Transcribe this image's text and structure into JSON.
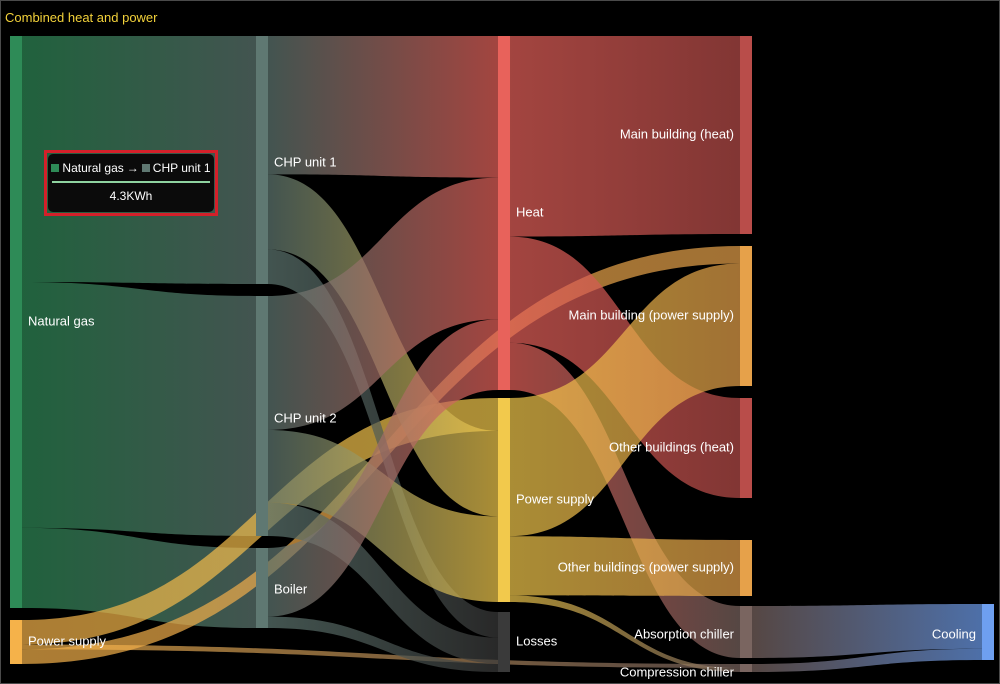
{
  "title": "Combined heat and power",
  "colors": {
    "Natural gas": "#2e8b57",
    "CHP unit 1": "#5f7872",
    "CHP unit 2": "#5f7872",
    "Boiler": "#5f7872",
    "Heat": "#e8625b",
    "Power supply": "#f2c94c",
    "Losses": "#3a3a3a",
    "Main building (heat)": "#b94d4a",
    "Main building (power supply)": "#e6a14a",
    "Other buildings (heat)": "#b94d4a",
    "Other buildings (power supply)": "#e6a14a",
    "Absorption chiller": "#7a6560",
    "Compression chiller": "#7a6560",
    "Cooling": "#6e9ff0",
    "Power supply (source)": "#f5b24a"
  },
  "chart_data": {
    "type": "sankey",
    "title": "Combined heat and power",
    "unit": "KWh",
    "nodes": [
      "Natural gas",
      "Power supply (source)",
      "CHP unit 1",
      "CHP unit 2",
      "Boiler",
      "Heat",
      "Power supply",
      "Losses",
      "Main building (heat)",
      "Main building (power supply)",
      "Other buildings (heat)",
      "Other buildings (power supply)",
      "Absorption chiller",
      "Compression chiller",
      "Cooling"
    ],
    "node_labels": {
      "Natural gas": "Natural gas",
      "Power supply (source)": "Power supply",
      "CHP unit 1": "CHP unit 1",
      "CHP unit 2": "CHP unit 2",
      "Boiler": "Boiler",
      "Heat": "Heat",
      "Power supply": "Power supply",
      "Losses": "Losses",
      "Main building (heat)": "Main building (heat)",
      "Main building (power supply)": "Main building (power supply)",
      "Other buildings (heat)": "Other buildings (heat)",
      "Other buildings (power supply)": "Other buildings (power supply)",
      "Absorption chiller": "Absorption chiller",
      "Compression chiller": "Compression chiller",
      "Cooling": "Cooling"
    },
    "links": [
      {
        "source": "Natural gas",
        "target": "CHP unit 1",
        "value": 4.3
      },
      {
        "source": "Natural gas",
        "target": "CHP unit 2",
        "value": 4.3
      },
      {
        "source": "Natural gas",
        "target": "Boiler",
        "value": 1.4
      },
      {
        "source": "Power supply (source)",
        "target": "Power supply",
        "value": 0.5
      },
      {
        "source": "Power supply (source)",
        "target": "Compression chiller",
        "value": 0.1
      },
      {
        "source": "Power supply (source)",
        "target": "Main building (power supply)",
        "value": 0.3
      },
      {
        "source": "CHP unit 1",
        "target": "Heat",
        "value": 2.4
      },
      {
        "source": "CHP unit 1",
        "target": "Power supply",
        "value": 1.3
      },
      {
        "source": "CHP unit 1",
        "target": "Losses",
        "value": 0.6
      },
      {
        "source": "CHP unit 2",
        "target": "Heat",
        "value": 2.4
      },
      {
        "source": "CHP unit 2",
        "target": "Power supply",
        "value": 1.3
      },
      {
        "source": "CHP unit 2",
        "target": "Losses",
        "value": 0.6
      },
      {
        "source": "Boiler",
        "target": "Heat",
        "value": 1.2
      },
      {
        "source": "Boiler",
        "target": "Losses",
        "value": 0.2
      },
      {
        "source": "Heat",
        "target": "Main building (heat)",
        "value": 3.4
      },
      {
        "source": "Heat",
        "target": "Other buildings (heat)",
        "value": 1.8
      },
      {
        "source": "Heat",
        "target": "Absorption chiller",
        "value": 0.8
      },
      {
        "source": "Power supply",
        "target": "Main building (power supply)",
        "value": 2.1
      },
      {
        "source": "Power supply",
        "target": "Other buildings (power supply)",
        "value": 0.9
      },
      {
        "source": "Power supply",
        "target": "Compression chiller",
        "value": 0.1
      },
      {
        "source": "Absorption chiller",
        "target": "Cooling",
        "value": 0.8
      },
      {
        "source": "Compression chiller",
        "target": "Cooling",
        "value": 0.2
      }
    ]
  },
  "tooltip": {
    "source": "Natural gas",
    "arrow": "→",
    "target": "CHP unit 1",
    "value": "4.3KWh",
    "source_color": "#2e8b57",
    "target_color": "#5f7872"
  }
}
